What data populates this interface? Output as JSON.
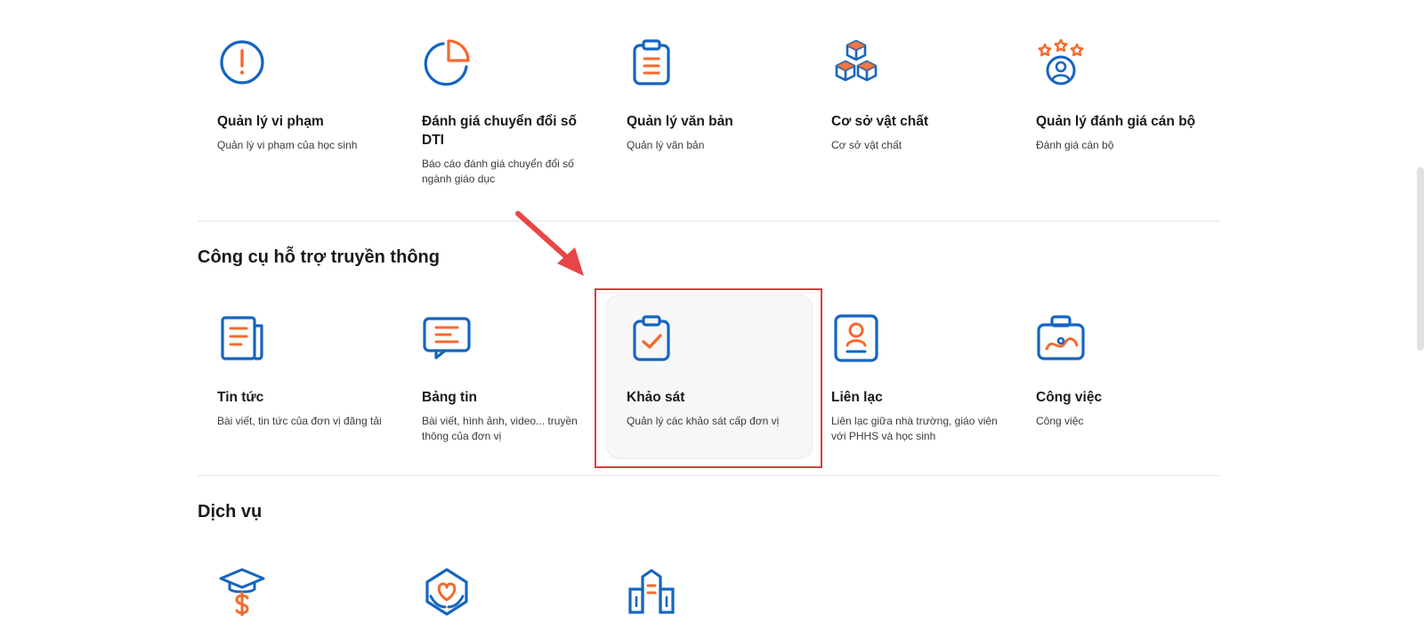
{
  "top_row": [
    {
      "title": "Quản lý vi phạm",
      "desc": "Quản lý vi phạm của học sinh",
      "icon": "alert-circle-icon"
    },
    {
      "title": "Đánh giá chuyển đổi số DTI",
      "desc": "Báo cáo đánh giá chuyển đổi số ngành giáo dục",
      "icon": "pie-chart-icon"
    },
    {
      "title": "Quản lý văn bản",
      "desc": "Quản lý văn bản",
      "icon": "clipboard-list-icon"
    },
    {
      "title": "Cơ sở vật chất",
      "desc": "Cơ sở vật chất",
      "icon": "boxes-icon"
    },
    {
      "title": "Quản lý đánh giá cán bộ",
      "desc": "Đánh giá cán bộ",
      "icon": "user-stars-icon"
    }
  ],
  "sections": {
    "communication": {
      "title": "Công cụ hỗ trợ truyền thông",
      "items": [
        {
          "title": "Tin tức",
          "desc": "Bài viết, tin tức của đơn vị đăng tải",
          "icon": "newspaper-icon"
        },
        {
          "title": "Bảng tin",
          "desc": "Bài viết, hình ảnh, video... truyền thông của đơn vị",
          "icon": "message-board-icon"
        },
        {
          "title": "Khảo sát",
          "desc": "Quản lý các khảo sát cấp đơn vị",
          "icon": "clipboard-check-icon"
        },
        {
          "title": "Liên lạc",
          "desc": "Liên lạc giữa nhà trường, giáo viên với PHHS và học sinh",
          "icon": "contact-card-icon"
        },
        {
          "title": "Công việc",
          "desc": "Công việc",
          "icon": "briefcase-icon"
        }
      ]
    },
    "services": {
      "title": "Dịch vụ",
      "items": [
        {
          "icon": "graduation-dollar-icon"
        },
        {
          "icon": "heart-hands-icon"
        },
        {
          "icon": "school-building-icon"
        }
      ]
    }
  },
  "colors": {
    "blue": "#1565c0",
    "orange": "#f26a2e",
    "highlight_red": "#e03b3b"
  }
}
